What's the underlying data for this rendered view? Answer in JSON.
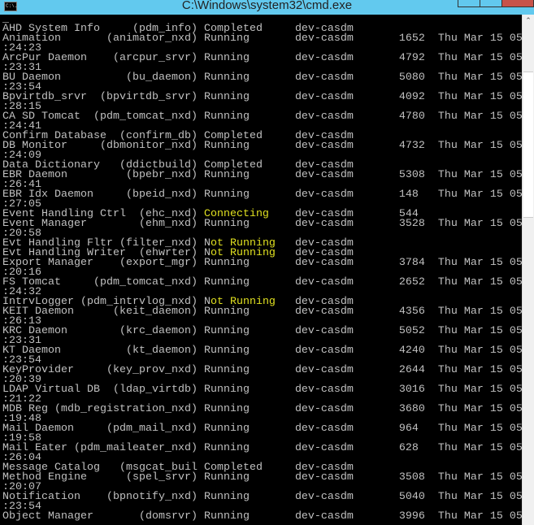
{
  "window": {
    "title": "C:\\Windows\\system32\\cmd.exe",
    "icon_label": "C:\\.",
    "cursor": "_"
  },
  "colors": {
    "text": "#c0c0c0",
    "highlight": "#e0e020",
    "titlebar": "#62c9ee",
    "close": "#c7534a"
  },
  "services": [
    {
      "name": "AHD System Info",
      "proc": "(pdm_info)",
      "status": "Completed",
      "host": "dev-casdm",
      "pid": "",
      "started": ""
    },
    {
      "name": "Animation",
      "proc": "(animator_nxd)",
      "status": "Running",
      "host": "dev-casdm",
      "pid": "1652",
      "started": "Thu Mar 15 05",
      "cont": ":24:23"
    },
    {
      "name": "ArcPur Daemon",
      "proc": "(arcpur_srvr)",
      "status": "Running",
      "host": "dev-casdm",
      "pid": "4792",
      "started": "Thu Mar 15 05",
      "cont": ":23:31"
    },
    {
      "name": "BU Daemon",
      "proc": "(bu_daemon)",
      "status": "Running",
      "host": "dev-casdm",
      "pid": "5080",
      "started": "Thu Mar 15 05",
      "cont": ":23:54"
    },
    {
      "name": "Bpvirtdb_srvr",
      "proc": "(bpvirtdb_srvr)",
      "status": "Running",
      "host": "dev-casdm",
      "pid": "4092",
      "started": "Thu Mar 15 05",
      "cont": ":28:15"
    },
    {
      "name": "CA SD Tomcat",
      "proc": "(pdm_tomcat_nxd)",
      "status": "Running",
      "host": "dev-casdm",
      "pid": "4780",
      "started": "Thu Mar 15 05",
      "cont": ":24:41"
    },
    {
      "name": "Confirm Database",
      "proc": "(confirm_db)",
      "status": "Completed",
      "host": "dev-casdm",
      "pid": "",
      "started": ""
    },
    {
      "name": "DB Monitor",
      "proc": "(dbmonitor_nxd)",
      "status": "Running",
      "host": "dev-casdm",
      "pid": "4732",
      "started": "Thu Mar 15 05",
      "cont": ":24:09"
    },
    {
      "name": "Data Dictionary",
      "proc": "(ddictbuild)",
      "status": "Completed",
      "host": "dev-casdm",
      "pid": "",
      "started": ""
    },
    {
      "name": "EBR Daemon",
      "proc": "(bpebr_nxd)",
      "status": "Running",
      "host": "dev-casdm",
      "pid": "5308",
      "started": "Thu Mar 15 05",
      "cont": ":26:41"
    },
    {
      "name": "EBR Idx Daemon",
      "proc": "(bpeid_nxd)",
      "status": "Running",
      "host": "dev-casdm",
      "pid": "148",
      "started": "Thu Mar 15 05",
      "cont": ":27:05"
    },
    {
      "name": "Event Handling Ctrl",
      "proc": "(ehc_nxd)",
      "status": "Connecting",
      "host": "dev-casdm",
      "pid": "544",
      "started": ""
    },
    {
      "name": "Event Manager",
      "proc": "(ehm_nxd)",
      "status": "Running",
      "host": "dev-casdm",
      "pid": "3528",
      "started": "Thu Mar 15 05",
      "cont": ":20:58"
    },
    {
      "name": "Evt Handling Fltr",
      "proc": "(filter_nxd)",
      "status": "Not Running",
      "host": "dev-casdm",
      "pid": "",
      "started": ""
    },
    {
      "name": "Evt Handling Writer",
      "proc": "(ehwrter)",
      "status": "Not Running",
      "host": "dev-casdm",
      "pid": "",
      "started": ""
    },
    {
      "name": "Export Manager",
      "proc": "(export_mgr)",
      "status": "Running",
      "host": "dev-casdm",
      "pid": "3784",
      "started": "Thu Mar 15 05",
      "cont": ":20:16"
    },
    {
      "name": "FS Tomcat",
      "proc": "(pdm_tomcat_nxd)",
      "status": "Running",
      "host": "dev-casdm",
      "pid": "2652",
      "started": "Thu Mar 15 05",
      "cont": ":24:32"
    },
    {
      "name": "IntrvLogger",
      "proc": "(pdm_intrvlog_nxd)",
      "status": "Not Running",
      "host": "dev-casdm",
      "pid": "",
      "started": ""
    },
    {
      "name": "KEIT Daemon",
      "proc": "(keit_daemon)",
      "status": "Running",
      "host": "dev-casdm",
      "pid": "4356",
      "started": "Thu Mar 15 05",
      "cont": ":26:13"
    },
    {
      "name": "KRC Daemon",
      "proc": "(krc_daemon)",
      "status": "Running",
      "host": "dev-casdm",
      "pid": "5052",
      "started": "Thu Mar 15 05",
      "cont": ":23:31"
    },
    {
      "name": "KT Daemon",
      "proc": "(kt_daemon)",
      "status": "Running",
      "host": "dev-casdm",
      "pid": "4240",
      "started": "Thu Mar 15 05",
      "cont": ":23:54"
    },
    {
      "name": "KeyProvider",
      "proc": "(key_prov_nxd)",
      "status": "Running",
      "host": "dev-casdm",
      "pid": "2644",
      "started": "Thu Mar 15 05",
      "cont": ":20:39"
    },
    {
      "name": "LDAP Virtual DB",
      "proc": "(ldap_virtdb)",
      "status": "Running",
      "host": "dev-casdm",
      "pid": "3016",
      "started": "Thu Mar 15 05",
      "cont": ":21:22"
    },
    {
      "name": "MDB Reg",
      "proc": "(mdb_registration_nxd)",
      "status": "Running",
      "host": "dev-casdm",
      "pid": "3680",
      "started": "Thu Mar 15 05",
      "cont": ":19:48"
    },
    {
      "name": "Mail Daemon",
      "proc": "(pdm_mail_nxd)",
      "status": "Running",
      "host": "dev-casdm",
      "pid": "964",
      "started": "Thu Mar 15 05",
      "cont": ":19:58"
    },
    {
      "name": "Mail Eater",
      "proc": "(pdm_maileater_nxd)",
      "status": "Running",
      "host": "dev-casdm",
      "pid": "628",
      "started": "Thu Mar 15 05",
      "cont": ":26:04"
    },
    {
      "name": "Message Catalog",
      "proc": "(msgcat_buil",
      "status": "Completed",
      "host": "dev-casdm",
      "pid": "",
      "started": ""
    },
    {
      "name": "Method Engine",
      "proc": "(spel_srvr)",
      "status": "Running",
      "host": "dev-casdm",
      "pid": "3508",
      "started": "Thu Mar 15 05",
      "cont": ":20:07"
    },
    {
      "name": "Notification",
      "proc": "(bpnotify_nxd)",
      "status": "Running",
      "host": "dev-casdm",
      "pid": "5040",
      "started": "Thu Mar 15 05",
      "cont": ":23:54"
    },
    {
      "name": "Object Manager",
      "proc": "(domsrvr)",
      "status": "Running",
      "host": "dev-casdm",
      "pid": "3996",
      "started": "Thu Mar 15 05"
    }
  ]
}
